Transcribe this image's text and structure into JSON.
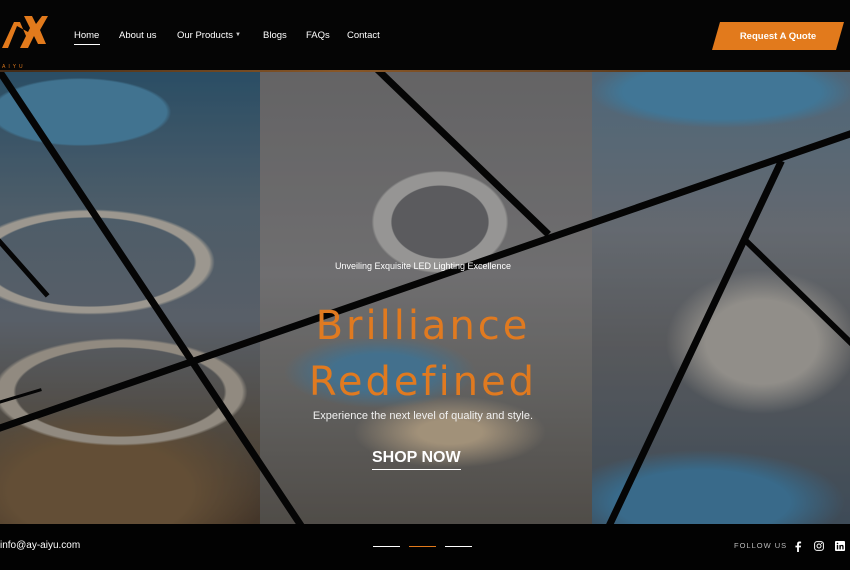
{
  "brand": {
    "logo_text": "AIYU",
    "accent_color": "#e27a1c"
  },
  "nav": {
    "items": [
      {
        "label": "Home",
        "active": true
      },
      {
        "label": "About us"
      },
      {
        "label": "Our Products",
        "has_dropdown": true
      },
      {
        "label": "Blogs"
      },
      {
        "label": "FAQs"
      },
      {
        "label": "Contact"
      }
    ],
    "cta_label": "Request A Quote"
  },
  "hero": {
    "eyebrow": "Unveiling Exquisite LED Lighting Excellence",
    "headline_line1": "Brilliance",
    "headline_line2": "Redefined",
    "subtitle": "Experience the next level of quality and style.",
    "cta_label": "SHOP NOW"
  },
  "footer": {
    "email": "info@ay-aiyu.com",
    "slider_count": 3,
    "slider_active": 2,
    "follow_label": "FOLLOW US",
    "social_icons": [
      "facebook-icon",
      "instagram-icon",
      "linkedin-icon"
    ]
  }
}
